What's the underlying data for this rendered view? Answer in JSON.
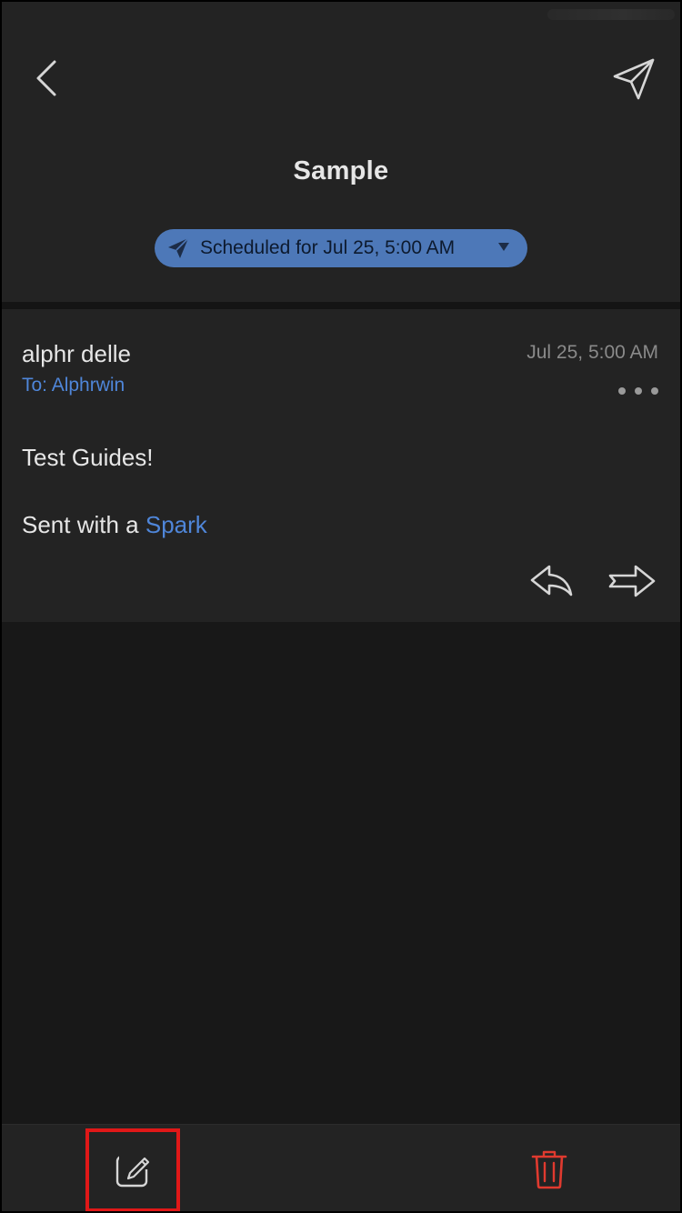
{
  "header": {
    "title": "Sample",
    "schedule_label": "Scheduled for Jul 25, 5:00 AM"
  },
  "message": {
    "sender": "alphr delle",
    "recipient": "To: Alphrwin",
    "time": "Jul 25, 5:00 AM",
    "body": "Test Guides!",
    "signature_prefix": "Sent with a ",
    "signature_link": "Spark"
  },
  "icons": {
    "back": "chevron-left-icon",
    "send": "paper-plane-icon",
    "schedule": "paper-plane-icon",
    "more": "more-horizontal-icon",
    "reply": "reply-icon",
    "forward": "forward-icon",
    "edit": "edit-icon",
    "delete": "trash-icon"
  },
  "colors": {
    "background": "#181818",
    "surface": "#232323",
    "accent": "#4f86d9",
    "pill": "#4d78b8",
    "danger": "#e03a2f",
    "highlight_box": "#e01818"
  }
}
